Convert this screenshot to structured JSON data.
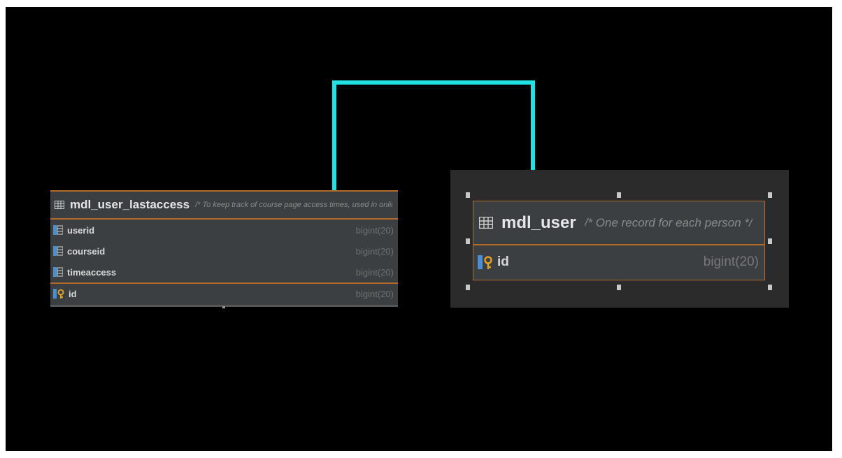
{
  "colors": {
    "background": "#000000",
    "relation_line": "#22e3e3",
    "table_fill": "#3c3f41",
    "table_border": "#b36b2a",
    "selection_panel": "#2b2b2b",
    "selection_handle": "#c8c8c8"
  },
  "tables": [
    {
      "name": "mdl_user_lastaccess",
      "comment": "/* To keep track of course page access times, used in online pa */",
      "icon": "table-grid-icon",
      "columns": [
        {
          "name": "userid",
          "type": "bigint(20)",
          "icon": "column-icon"
        },
        {
          "name": "courseid",
          "type": "bigint(20)",
          "icon": "column-icon"
        },
        {
          "name": "timeaccess",
          "type": "bigint(20)",
          "icon": "column-icon"
        }
      ],
      "primary_key": {
        "name": "id",
        "type": "bigint(20)",
        "icon": "primary-key-icon"
      }
    },
    {
      "name": "mdl_user",
      "comment": "/* One record for each person */",
      "icon": "table-grid-icon",
      "selected": true,
      "columns": [],
      "primary_key": {
        "name": "id",
        "type": "bigint(20)",
        "icon": "primary-key-icon"
      }
    }
  ],
  "relation": {
    "from": "mdl_user_lastaccess",
    "to": "mdl_user"
  }
}
